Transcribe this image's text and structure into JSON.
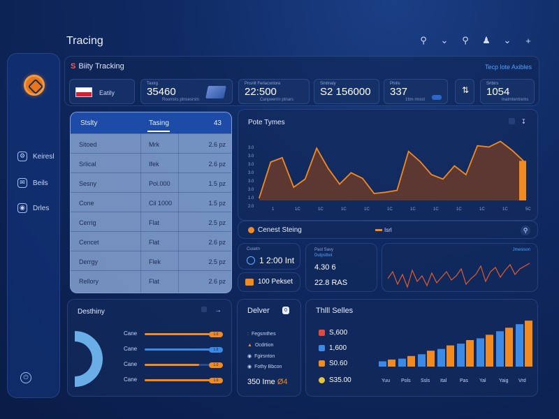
{
  "app_title": "Tracing",
  "top_tools": [
    "search-icon",
    "chevron-down-icon",
    "search-icon",
    "user-icon",
    "chevron-down-icon",
    "plus-icon"
  ],
  "sidebar": {
    "items": [
      {
        "label": "Keiresl",
        "icon": "gear-icon"
      },
      {
        "label": "Beils",
        "icon": "mail-icon"
      },
      {
        "label": "Drles",
        "icon": "settings-icon"
      }
    ]
  },
  "main": {
    "title": "Biity Tracking",
    "title_prefix": "S",
    "link": "Tecp lote Axibles",
    "kpis": [
      {
        "name": "Eatily"
      },
      {
        "label": "Taxirg",
        "value": "35460",
        "sub": "Roomsts ptnsesrstn"
      },
      {
        "label": "Pnsnlt Ferlacxnlore",
        "value": "22:500",
        "sub": "Canpeerrin ptnars"
      },
      {
        "label": "Sintinaly",
        "value": "S2 156000"
      },
      {
        "label": "Ptnlls",
        "value": "337",
        "sub": "1ttm rmsst"
      },
      {
        "label": "Srtbirs",
        "value": "1054",
        "sub": "Inatmtentrems"
      }
    ]
  },
  "table": {
    "headers": [
      "Stslty",
      "Tasing",
      "43"
    ],
    "rows": [
      {
        "c1": "Sitoed",
        "c2": "Mrk",
        "c3": "2.6 pz"
      },
      {
        "c1": "Srlical",
        "c2": "Ifek",
        "c3": "2.6 pz"
      },
      {
        "c1": "Sesny",
        "c2": "Pol.000",
        "c3": "1.5 pz"
      },
      {
        "c1": "Cone",
        "c2": "Cil 1000",
        "c3": "1.5 pz"
      },
      {
        "c1": "Cerrig",
        "c2": "Flat",
        "c3": "2.5 pz"
      },
      {
        "c1": "Cencet",
        "c2": "Flat",
        "c3": "2.6 pz"
      },
      {
        "c1": "Derrgy",
        "c2": "Flek",
        "c3": "2.5 pz"
      },
      {
        "c1": "Rellory",
        "c2": "Flat",
        "c3": "2.6 pz"
      }
    ]
  },
  "perf_chart": {
    "title": "Pote Tymes",
    "colors": {
      "line": "#f28a22",
      "fill": "#6b3b2a"
    }
  },
  "chart_data": [
    {
      "type": "area",
      "title": "Pote Tymes",
      "x": [
        "1",
        "1C",
        "1C",
        "1C",
        "1C",
        "1C",
        "1C",
        "1C",
        "1C",
        "1C",
        "1C",
        "5C"
      ],
      "y_ticks": [
        "3.0",
        "3.0",
        "3.0",
        "3.0",
        "3.0",
        "3.0",
        "1.0",
        "2.0"
      ],
      "values": [
        4,
        61,
        68,
        21,
        34,
        83,
        51,
        26,
        44,
        35,
        11,
        13,
        16,
        78,
        62,
        41,
        34,
        55,
        41,
        87,
        85,
        94,
        80,
        63
      ],
      "ylim": [
        0,
        100
      ]
    },
    {
      "type": "bar",
      "title": "Thlll Selles",
      "categories": [
        "Yuu",
        "Pols",
        "Ssls",
        "Ital",
        "Pas",
        "Yal",
        "Yaig",
        "Vrd"
      ],
      "series": [
        {
          "values": [
            6,
            9,
            14,
            20,
            26,
            32,
            40,
            48
          ]
        },
        {
          "values": [
            8,
            12,
            18,
            24,
            30,
            36,
            44,
            52
          ]
        }
      ],
      "ylim": [
        0,
        60
      ]
    }
  ],
  "strip": {
    "title": "Cenest Steing",
    "legend": "Isrl"
  },
  "cards": {
    "a_label": "Cusetn",
    "a_value": "1 2:00 Int",
    "b_value": "100 Pekset",
    "c_label": "Past Savy",
    "c_sub": "Dutpstbot",
    "c_value1": "4.30 6",
    "c_value2": "22.8 RAS",
    "d_legend": "Jmesison"
  },
  "dest": {
    "title": "Desthiny",
    "rows": [
      {
        "label": "Cane",
        "color": "#f28a22",
        "pill": "1.0",
        "fill": 0.85
      },
      {
        "label": "Cane",
        "color": "#3b8ae6",
        "pill": "1.6",
        "fill": 0.85
      },
      {
        "label": "Cane",
        "color": "#f28a22",
        "pill": "1.0",
        "fill": 0.7
      },
      {
        "label": "Cane",
        "color": "#f28a22",
        "pill": "1.0",
        "fill": 0.9
      }
    ],
    "donut_color": "#6aaee8"
  },
  "deliver": {
    "title": "Delver",
    "badge": "0",
    "items": [
      "Fegsmthes",
      "Ocdrtion",
      "Fgirsnton",
      "Fothy Bbcon"
    ],
    "foot_value": "350 Ime",
    "foot_accent": "Ø4"
  },
  "sales": {
    "title": "Thlll Selles",
    "legend": [
      {
        "value": "S,600",
        "color": "#e24b3c"
      },
      {
        "value": "1,600",
        "color": "#3b8ae6"
      },
      {
        "value": "S0.60",
        "color": "#f28a22"
      },
      {
        "value": "S35.00",
        "color": "#e8c23a"
      }
    ],
    "colors": {
      "blue": "#3b8ae6",
      "orange": "#f28a22"
    }
  }
}
